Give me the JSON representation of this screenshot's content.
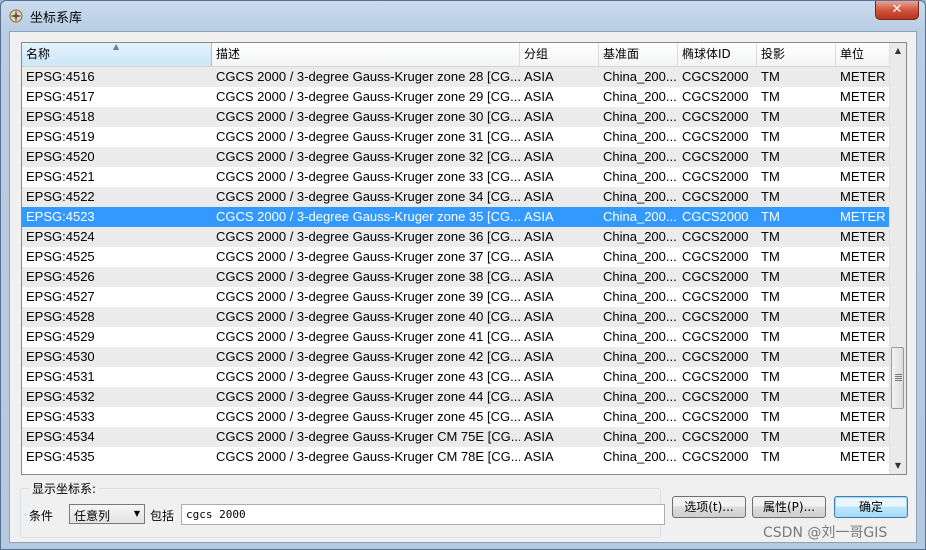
{
  "window": {
    "title": "坐标系库",
    "close_label": "✕"
  },
  "table": {
    "columns": [
      "名称",
      "描述",
      "分组",
      "基准面",
      "椭球体ID",
      "投影",
      "单位"
    ],
    "selected_index": 7,
    "rows": [
      [
        "EPSG:4516",
        "CGCS 2000 / 3-degree Gauss-Kruger zone 28 [CG...",
        "ASIA",
        "China_200...",
        "CGCS2000",
        "TM",
        "METER"
      ],
      [
        "EPSG:4517",
        "CGCS 2000 / 3-degree Gauss-Kruger zone 29 [CG...",
        "ASIA",
        "China_200...",
        "CGCS2000",
        "TM",
        "METER"
      ],
      [
        "EPSG:4518",
        "CGCS 2000 / 3-degree Gauss-Kruger zone 30 [CG...",
        "ASIA",
        "China_200...",
        "CGCS2000",
        "TM",
        "METER"
      ],
      [
        "EPSG:4519",
        "CGCS 2000 / 3-degree Gauss-Kruger zone 31 [CG...",
        "ASIA",
        "China_200...",
        "CGCS2000",
        "TM",
        "METER"
      ],
      [
        "EPSG:4520",
        "CGCS 2000 / 3-degree Gauss-Kruger zone 32 [CG...",
        "ASIA",
        "China_200...",
        "CGCS2000",
        "TM",
        "METER"
      ],
      [
        "EPSG:4521",
        "CGCS 2000 / 3-degree Gauss-Kruger zone 33 [CG...",
        "ASIA",
        "China_200...",
        "CGCS2000",
        "TM",
        "METER"
      ],
      [
        "EPSG:4522",
        "CGCS 2000 / 3-degree Gauss-Kruger zone 34 [CG...",
        "ASIA",
        "China_200...",
        "CGCS2000",
        "TM",
        "METER"
      ],
      [
        "EPSG:4523",
        "CGCS 2000 / 3-degree Gauss-Kruger zone 35 [CG...",
        "ASIA",
        "China_200...",
        "CGCS2000",
        "TM",
        "METER"
      ],
      [
        "EPSG:4524",
        "CGCS 2000 / 3-degree Gauss-Kruger zone 36 [CG...",
        "ASIA",
        "China_200...",
        "CGCS2000",
        "TM",
        "METER"
      ],
      [
        "EPSG:4525",
        "CGCS 2000 / 3-degree Gauss-Kruger zone 37 [CG...",
        "ASIA",
        "China_200...",
        "CGCS2000",
        "TM",
        "METER"
      ],
      [
        "EPSG:4526",
        "CGCS 2000 / 3-degree Gauss-Kruger zone 38 [CG...",
        "ASIA",
        "China_200...",
        "CGCS2000",
        "TM",
        "METER"
      ],
      [
        "EPSG:4527",
        "CGCS 2000 / 3-degree Gauss-Kruger zone 39 [CG...",
        "ASIA",
        "China_200...",
        "CGCS2000",
        "TM",
        "METER"
      ],
      [
        "EPSG:4528",
        "CGCS 2000 / 3-degree Gauss-Kruger zone 40 [CG...",
        "ASIA",
        "China_200...",
        "CGCS2000",
        "TM",
        "METER"
      ],
      [
        "EPSG:4529",
        "CGCS 2000 / 3-degree Gauss-Kruger zone 41 [CG...",
        "ASIA",
        "China_200...",
        "CGCS2000",
        "TM",
        "METER"
      ],
      [
        "EPSG:4530",
        "CGCS 2000 / 3-degree Gauss-Kruger zone 42 [CG...",
        "ASIA",
        "China_200...",
        "CGCS2000",
        "TM",
        "METER"
      ],
      [
        "EPSG:4531",
        "CGCS 2000 / 3-degree Gauss-Kruger zone 43 [CG...",
        "ASIA",
        "China_200...",
        "CGCS2000",
        "TM",
        "METER"
      ],
      [
        "EPSG:4532",
        "CGCS 2000 / 3-degree Gauss-Kruger zone 44 [CG...",
        "ASIA",
        "China_200...",
        "CGCS2000",
        "TM",
        "METER"
      ],
      [
        "EPSG:4533",
        "CGCS 2000 / 3-degree Gauss-Kruger zone 45 [CG...",
        "ASIA",
        "China_200...",
        "CGCS2000",
        "TM",
        "METER"
      ],
      [
        "EPSG:4534",
        "CGCS 2000 / 3-degree Gauss-Kruger CM 75E [CG...",
        "ASIA",
        "China_200...",
        "CGCS2000",
        "TM",
        "METER"
      ],
      [
        "EPSG:4535",
        "CGCS 2000 / 3-degree Gauss-Kruger CM 78E [CG...",
        "ASIA",
        "China_200...",
        "CGCS2000",
        "TM",
        "METER"
      ]
    ]
  },
  "filter": {
    "group_label": "显示坐标系:",
    "condition_label": "条件",
    "condition_value": "任意列",
    "contains_label": "包括",
    "search_value": "cgcs 2000"
  },
  "buttons": {
    "options": "选项(t)...",
    "properties": "属性(P)...",
    "ok": "确定"
  },
  "watermark": "CSDN @刘一哥GIS"
}
